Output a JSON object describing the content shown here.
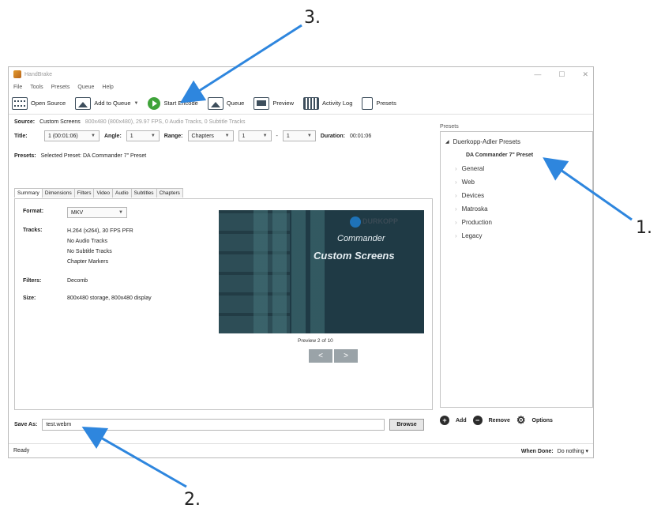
{
  "annotations": [
    "3.",
    "1.",
    "2."
  ],
  "colors": {
    "arrow": "#2e86de",
    "start_encode": "#3fa33a"
  },
  "window": {
    "title": "HandBrake",
    "menu": [
      "File",
      "Tools",
      "Presets",
      "Queue",
      "Help"
    ]
  },
  "toolbar": {
    "open_source": "Open Source",
    "add_to_queue": "Add to Queue",
    "start_encode": "Start Encode",
    "queue": "Queue",
    "preview": "Preview",
    "activity_log": "Activity Log",
    "presets": "Presets"
  },
  "source": {
    "label": "Source:",
    "name": "Custom Screens",
    "info": "800x480 (800x480), 29.97 FPS, 0 Audio Tracks, 0 Subtitle Tracks"
  },
  "title_row": {
    "title_label": "Title:",
    "title_value": "1 (00:01:06)",
    "angle_label": "Angle:",
    "angle_value": "1",
    "range_label": "Range:",
    "range_value": "Chapters",
    "range_from": "1",
    "range_sep": "-",
    "range_to": "1",
    "duration_label": "Duration:",
    "duration_value": "00:01:06"
  },
  "presets_row": {
    "label": "Presets:",
    "value": "Selected Preset: DA Commander 7\" Preset"
  },
  "tabs": [
    "Summary",
    "Dimensions",
    "Filters",
    "Video",
    "Audio",
    "Subtitles",
    "Chapters"
  ],
  "summary": {
    "format_label": "Format:",
    "format_value": "MKV",
    "tracks_label": "Tracks:",
    "tracks": [
      "H.264 (x264), 30 FPS PFR",
      "No Audio Tracks",
      "No Subtitle Tracks",
      "Chapter Markers"
    ],
    "filters_label": "Filters:",
    "filters_value": "Decomb",
    "size_label": "Size:",
    "size_value": "800x480 storage, 800x480 display"
  },
  "preview": {
    "logo": "DURKOPP",
    "line1": "Commander",
    "line2": "Custom Screens",
    "caption": "Preview 2 of 10",
    "prev": "<",
    "next": ">"
  },
  "save": {
    "label": "Save As:",
    "value": "test.webm",
    "browse": "Browse"
  },
  "presets_panel": {
    "heading": "Presets",
    "group": "Duerkopp-Adler Presets",
    "selected": "DA Commander 7\" Preset",
    "categories": [
      "General",
      "Web",
      "Devices",
      "Matroska",
      "Production",
      "Legacy"
    ],
    "add": "Add",
    "remove": "Remove",
    "options": "Options"
  },
  "status": {
    "ready": "Ready",
    "when_done_label": "When Done:",
    "when_done_value": "Do nothing"
  }
}
